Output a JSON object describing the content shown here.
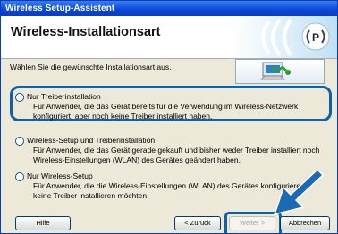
{
  "window": {
    "title": "Wireless Setup-Assistent"
  },
  "header": {
    "title": "Wireless-Installationsart"
  },
  "intro": "Wählen Sie die gewünschte Installationsart aus.",
  "options": [
    {
      "title": "Nur Treiberinstallation",
      "desc": "Für Anwender, die das Gerät bereits für die Verwendung im Wireless-Netzwerk\nkonfiguriert, aber noch keine Treiber installiert haben."
    },
    {
      "title": "Wireless-Setup und Treiberinstallation",
      "desc": "Für Anwender, die das Gerät gerade gekauft und bisher weder Treiber installiert noch\nWireless-Einstellungen (WLAN) des Gerätes geändert haben."
    },
    {
      "title": "Nur Wireless-Setup",
      "desc": "Für Anwender, die die Wireless-Einstellungen (WLAN) des Gerätes konfigurieren\nkeine Treiber installieren möchten."
    }
  ],
  "buttons": {
    "help": "Hilfe",
    "back": "< Zurück",
    "next": "Weiter >",
    "cancel": "Abbrechen"
  },
  "colors": {
    "highlight": "#1060a8",
    "titlebar": "#0846d8",
    "arrow": "#1a6ab4"
  },
  "icons": {
    "logo": "wireless-signal-logo",
    "computer": "computer-network-icon",
    "arrow": "pointer-arrow-icon"
  }
}
